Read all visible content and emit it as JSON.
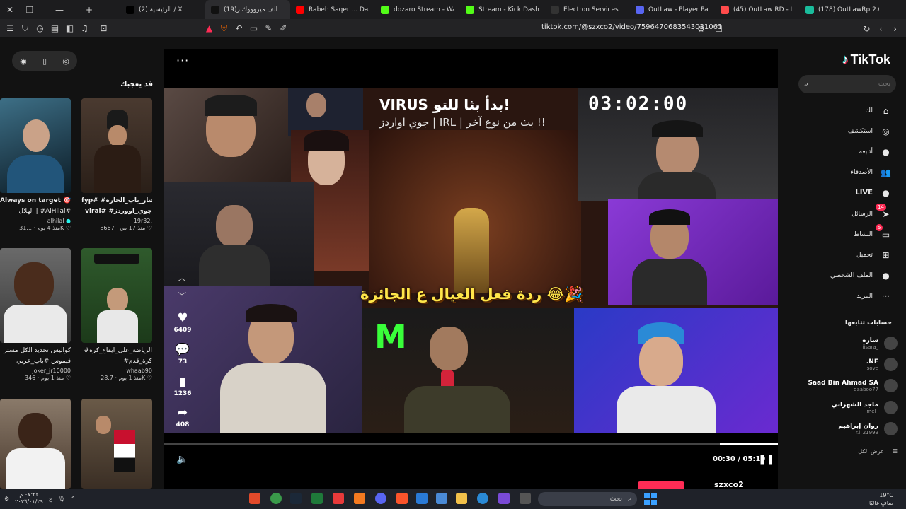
{
  "browser": {
    "tabs": [
      {
        "title": "(2) الرئيسية / X",
        "color": "#000000",
        "active": false
      },
      {
        "title": "(19)الف ميروووك ر",
        "color": "#111111",
        "active": true
      },
      {
        "title": "Rabeh Saqer ... Daafi",
        "color": "#ff0000",
        "active": false
      },
      {
        "title": "dozaro Stream - Watch Li",
        "color": "#53fc18",
        "active": false
      },
      {
        "title": "Stream - Kick Dashboa",
        "color": "#53fc18",
        "active": false
      },
      {
        "title": "Electron Services",
        "color": "#333333",
        "active": false
      },
      {
        "title": "OutLaw - Player Page",
        "color": "#5865f2",
        "active": false
      },
      {
        "title": "(45) OutLaw RD - Live Con",
        "color": "#ff4b4b",
        "active": false
      },
      {
        "title": "(178) OutLawRp 2.0 - Live",
        "color": "#1abc9c",
        "active": false
      }
    ],
    "url": "tiktok.com/@szxco2/video/7596470683543031061"
  },
  "tiktok": {
    "logo": "TikTok",
    "search_placeholder": "بحث",
    "nav": [
      {
        "label": "لك",
        "icon": "home-icon",
        "glyph": "⌂"
      },
      {
        "label": "استكشف",
        "icon": "compass-icon",
        "glyph": "◎"
      },
      {
        "label": "أتابعه",
        "icon": "following-avatar-icon",
        "glyph": "●"
      },
      {
        "label": "الأصدقاء",
        "icon": "friends-icon",
        "glyph": "👥"
      },
      {
        "label": "LIVE",
        "icon": "live-icon",
        "glyph": "●"
      },
      {
        "label": "الرسائل",
        "icon": "messages-icon",
        "glyph": "➤",
        "badge": "14"
      },
      {
        "label": "النشاط",
        "icon": "activity-icon",
        "glyph": "▭",
        "badge": "5"
      },
      {
        "label": "تحميل",
        "icon": "upload-icon",
        "glyph": "⊞"
      },
      {
        "label": "الملف الشخصي",
        "icon": "profile-icon",
        "glyph": "●"
      },
      {
        "label": "المزيد",
        "icon": "more-icon",
        "glyph": "···"
      }
    ],
    "following_title": "حسابات تتابعها",
    "following": [
      {
        "name": "سارة",
        "handle": "iisara_"
      },
      {
        "name": ".NF",
        "handle": "sove"
      },
      {
        "name": "Saad Bin Ahmad SA",
        "handle": "daaboo77"
      },
      {
        "name": "ماجد الشهراني",
        "handle": "imel_"
      },
      {
        "name": "روان إبراهيم",
        "handle": "r.i_21999"
      }
    ],
    "see_all": "عرض الكل",
    "you_may_like": "قد يعجبك",
    "recommended": [
      {
        "caption": "Always on target 🎯",
        "caption2": "الهلال | #AlHilal#",
        "author": "alhilal",
        "likes": "31.1K",
        "age": "منذ 4 يوم"
      },
      {
        "caption": "fyp# #مختار_باب_الحارة",
        "caption2": "viral# #جوي_اووردز",
        "author": "19r32.",
        "likes": "8667",
        "age": "منذ 17 س"
      },
      {
        "caption": "كواليس تحديد الكل مستر",
        "caption2": "فيموس #باب_عربي",
        "author": "joker_jr10000",
        "likes": "346",
        "age": "منذ 1 يوم"
      },
      {
        "caption": "#الرياضة_على_ايقاع_كرة",
        "caption2": "#كرة_قدم",
        "author": "whaab90",
        "likes": "28.7K",
        "age": "منذ 1 يوم"
      }
    ],
    "video": {
      "title_line1": "VIRUS بدأ بثا للتو!",
      "title_line2": "جوي اواردز | IRL | بث من نوع آخر !!",
      "timer": "03:02:00",
      "caption": "ردة فعل العيال ع الجائزة 😂🎉",
      "likes": "6409",
      "comments": "73",
      "saves": "1236",
      "shares": "408",
      "current_time": "00:30",
      "duration": "05:19",
      "progress": 0.094,
      "author": "szxco2"
    }
  },
  "taskbar": {
    "search_label": "بحث",
    "clock": "٠٧:٣٢ م",
    "date": "٢٠٢٦/٠١/٢٩",
    "temperature": "19°C",
    "weather": "صافٍ غالبًا",
    "lang": "ع"
  }
}
